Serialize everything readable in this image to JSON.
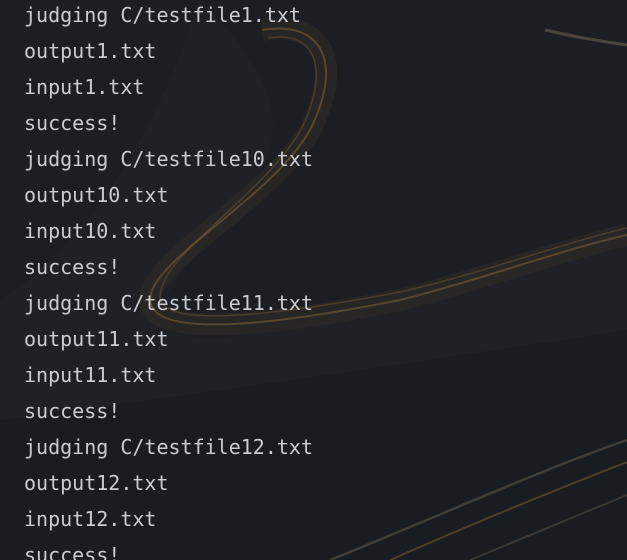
{
  "console": {
    "lines": [
      "judging C/testfile1.txt",
      "output1.txt",
      "input1.txt",
      "success!",
      "judging C/testfile10.txt",
      "output10.txt",
      "input10.txt",
      "success!",
      "judging C/testfile11.txt",
      "output11.txt",
      "input11.txt",
      "success!",
      "judging C/testfile12.txt",
      "output12.txt",
      "input12.txt",
      "success!"
    ]
  },
  "colors": {
    "text": "#c9ccd3",
    "background": "#1f2126",
    "road": "#b8893f"
  }
}
